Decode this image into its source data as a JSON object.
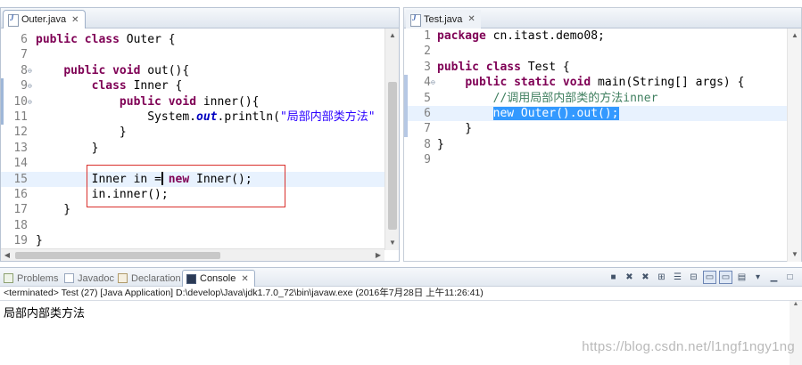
{
  "left_editor": {
    "tab": {
      "name": "Outer.java",
      "close": "✕"
    },
    "lines": [
      {
        "num": "6",
        "fold": "",
        "tokens": [
          {
            "t": "public",
            "c": "kw"
          },
          {
            "t": " "
          },
          {
            "t": "class",
            "c": "kw"
          },
          {
            "t": " Outer {"
          }
        ]
      },
      {
        "num": "7",
        "fold": "",
        "tokens": []
      },
      {
        "num": "8",
        "fold": "⊖",
        "tokens": [
          {
            "t": "    "
          },
          {
            "t": "public",
            "c": "kw"
          },
          {
            "t": " "
          },
          {
            "t": "void",
            "c": "kw"
          },
          {
            "t": " out(){"
          }
        ]
      },
      {
        "num": "9",
        "fold": "⊖",
        "tokens": [
          {
            "t": "        "
          },
          {
            "t": "class",
            "c": "kw"
          },
          {
            "t": " Inner {"
          }
        ]
      },
      {
        "num": "10",
        "fold": "⊖",
        "tokens": [
          {
            "t": "            "
          },
          {
            "t": "public",
            "c": "kw"
          },
          {
            "t": " "
          },
          {
            "t": "void",
            "c": "kw"
          },
          {
            "t": " inner(){"
          }
        ]
      },
      {
        "num": "11",
        "fold": "",
        "tokens": [
          {
            "t": "                System."
          },
          {
            "t": "out",
            "c": "it"
          },
          {
            "t": ".println("
          },
          {
            "t": "\"局部内部类方法\"",
            "c": "str"
          }
        ]
      },
      {
        "num": "12",
        "fold": "",
        "tokens": [
          {
            "t": "            }"
          }
        ]
      },
      {
        "num": "13",
        "fold": "",
        "tokens": [
          {
            "t": "        }"
          }
        ]
      },
      {
        "num": "14",
        "fold": "",
        "tokens": []
      },
      {
        "num": "15",
        "fold": "",
        "tokens": [
          {
            "t": "        Inner in "
          },
          {
            "t": "="
          },
          {
            "t": " "
          },
          {
            "t": "new",
            "c": "kw"
          },
          {
            "t": " Inner();"
          }
        ]
      },
      {
        "num": "16",
        "fold": "",
        "tokens": [
          {
            "t": "        in.inner();"
          }
        ]
      },
      {
        "num": "17",
        "fold": "",
        "tokens": [
          {
            "t": "    }"
          }
        ]
      },
      {
        "num": "18",
        "fold": "",
        "tokens": []
      },
      {
        "num": "19",
        "fold": "",
        "tokens": [
          {
            "t": "}"
          }
        ]
      }
    ]
  },
  "right_editor": {
    "tab": {
      "name": "Test.java",
      "close": "✕"
    },
    "lines": [
      {
        "num": "1",
        "fold": "",
        "tokens": [
          {
            "t": "package",
            "c": "kw"
          },
          {
            "t": " cn.itast.demo08;"
          }
        ]
      },
      {
        "num": "2",
        "fold": "",
        "tokens": []
      },
      {
        "num": "3",
        "fold": "",
        "tokens": [
          {
            "t": "public",
            "c": "kw"
          },
          {
            "t": " "
          },
          {
            "t": "class",
            "c": "kw"
          },
          {
            "t": " Test {"
          }
        ]
      },
      {
        "num": "4",
        "fold": "⊖",
        "tokens": [
          {
            "t": "    "
          },
          {
            "t": "public",
            "c": "kw"
          },
          {
            "t": " "
          },
          {
            "t": "static",
            "c": "kw"
          },
          {
            "t": " "
          },
          {
            "t": "void",
            "c": "kw"
          },
          {
            "t": " main(String[] args) {"
          }
        ]
      },
      {
        "num": "5",
        "fold": "",
        "tokens": [
          {
            "t": "        "
          },
          {
            "t": "//调用局部内部类的方法inner",
            "c": "com"
          }
        ]
      },
      {
        "num": "6",
        "fold": "",
        "tokens": [
          {
            "t": "        "
          },
          {
            "t": "new Outer().out();",
            "c": "sel"
          }
        ]
      },
      {
        "num": "7",
        "fold": "",
        "tokens": [
          {
            "t": "    }"
          }
        ]
      },
      {
        "num": "8",
        "fold": "",
        "tokens": [
          {
            "t": "}"
          }
        ]
      },
      {
        "num": "9",
        "fold": "",
        "tokens": []
      }
    ]
  },
  "bottom_panel": {
    "tabs": [
      {
        "label": "Problems",
        "icon": "problems"
      },
      {
        "label": "Javadoc",
        "icon": "javadoc"
      },
      {
        "label": "Declaration",
        "icon": "declaration"
      },
      {
        "label": "Console",
        "icon": "console",
        "close": "✕"
      }
    ],
    "status": "<terminated> Test (27) [Java Application] D:\\develop\\Java\\jdk1.7.0_72\\bin\\javaw.exe (2016年7月28日 上午11:26:41)",
    "output": "局部内部类方法",
    "toolbar_icons": [
      "terminate-icon",
      "remove-launch-icon",
      "remove-all-icon",
      "scroll-lock-icon",
      "clear-console-icon",
      "pin-console-icon",
      "word-wrap-icon",
      "display-selected-icon",
      "open-console-icon",
      "view-menu-icon",
      "minimize-icon",
      "maximize-icon"
    ]
  },
  "watermark": "https://blog.csdn.net/l1ngf1ngy1ng"
}
